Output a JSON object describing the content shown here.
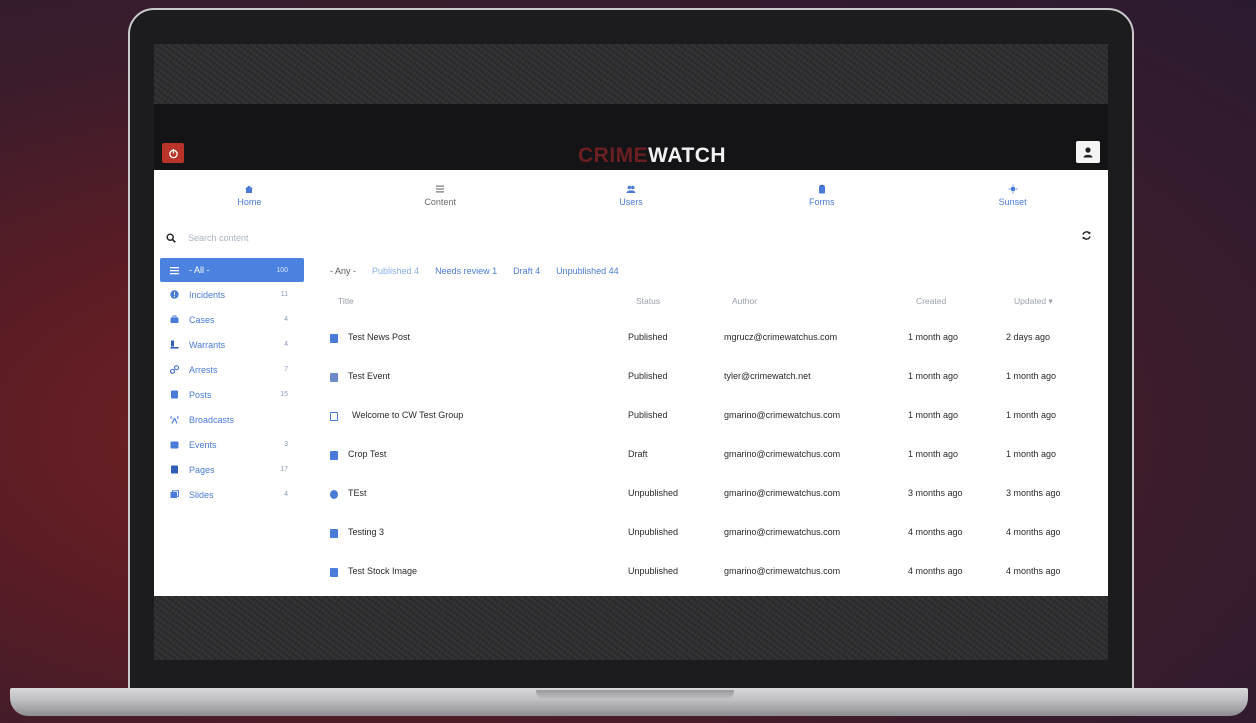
{
  "header": {
    "logo_crime": "CRIME",
    "logo_watch": "WATCH"
  },
  "nav": [
    {
      "label": "Home",
      "icon": "home-icon"
    },
    {
      "label": "Content",
      "icon": "list-icon"
    },
    {
      "label": "Users",
      "icon": "users-icon"
    },
    {
      "label": "Forms",
      "icon": "clipboard-icon"
    },
    {
      "label": "Sunset",
      "icon": "sun-icon"
    }
  ],
  "search": {
    "placeholder": "Search content"
  },
  "sidebar": {
    "items": [
      {
        "label": "- All -",
        "count": "100"
      },
      {
        "label": "Incidents",
        "count": "11"
      },
      {
        "label": "Cases",
        "count": "4"
      },
      {
        "label": "Warrants",
        "count": "4"
      },
      {
        "label": "Arrests",
        "count": "7"
      },
      {
        "label": "Posts",
        "count": "15"
      },
      {
        "label": "Broadcasts",
        "count": ""
      },
      {
        "label": "Events",
        "count": "3"
      },
      {
        "label": "Pages",
        "count": "17"
      },
      {
        "label": "Slides",
        "count": "4"
      }
    ]
  },
  "filters": [
    {
      "label": "- Any -"
    },
    {
      "label": "Published 4"
    },
    {
      "label": "Needs review 1"
    },
    {
      "label": "Draft 4"
    },
    {
      "label": "Unpublished 44"
    }
  ],
  "table": {
    "columns": [
      "Title",
      "Status",
      "Author",
      "Created",
      "Updated ▾"
    ],
    "rows": [
      {
        "title": "Test News Post",
        "status": "Published",
        "author": "mgrucz@crimewatchus.com",
        "created": "1 month ago",
        "updated": "2 days ago"
      },
      {
        "title": "Test Event",
        "status": "Published",
        "author": "tyler@crimewatch.net",
        "created": "1 month ago",
        "updated": "1 month ago"
      },
      {
        "title": "Welcome to CW Test Group",
        "status": "Published",
        "author": "gmarino@crimewatchus.com",
        "created": "1 month ago",
        "updated": "1 month ago"
      },
      {
        "title": "Crop Test",
        "status": "Draft",
        "author": "gmarino@crimewatchus.com",
        "created": "1 month ago",
        "updated": "1 month ago"
      },
      {
        "title": "TEst",
        "status": "Unpublished",
        "author": "gmarino@crimewatchus.com",
        "created": "3 months ago",
        "updated": "3 months ago"
      },
      {
        "title": "Testing 3",
        "status": "Unpublished",
        "author": "gmarino@crimewatchus.com",
        "created": "4 months ago",
        "updated": "4 months ago"
      },
      {
        "title": "Test Stock Image",
        "status": "Unpublished",
        "author": "gmarino@crimewatchus.com",
        "created": "4 months ago",
        "updated": "4 months ago"
      }
    ]
  },
  "colors": {
    "accent": "#4b82e0",
    "brand": "#b8342a"
  }
}
